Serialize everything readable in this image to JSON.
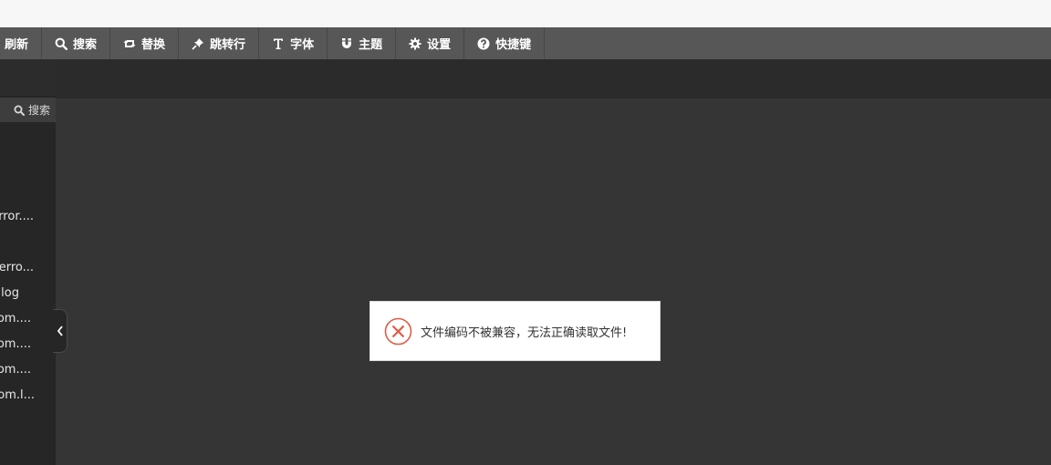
{
  "toolbar": {
    "items": [
      {
        "label": "刷新",
        "icon": "none"
      },
      {
        "label": "搜索",
        "icon": "search-icon"
      },
      {
        "label": "替换",
        "icon": "retweet-icon"
      },
      {
        "label": "跳转行",
        "icon": "pin-icon"
      },
      {
        "label": "字体",
        "icon": "text-icon"
      },
      {
        "label": "主题",
        "icon": "magnet-icon"
      },
      {
        "label": "设置",
        "icon": "gear-icon"
      },
      {
        "label": "快捷键",
        "icon": "question-icon"
      }
    ]
  },
  "sidebar": {
    "search_label": "搜索",
    "files": [
      "rror....",
      "erro...",
      "log",
      "om....",
      "om....",
      "om....",
      "om.l..."
    ]
  },
  "toast": {
    "message": "文件编码不被兼容，无法正确读取文件!",
    "icon": "error-circle-icon",
    "accent_color": "#e05a48"
  }
}
